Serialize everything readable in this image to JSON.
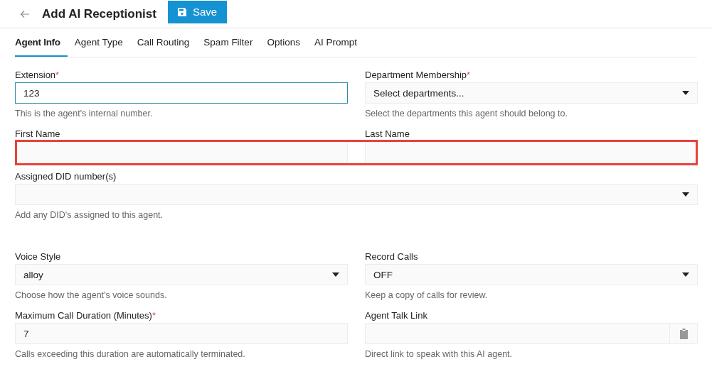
{
  "header": {
    "title": "Add AI Receptionist",
    "save_button": "Save"
  },
  "tabs": [
    {
      "label": "Agent Info",
      "selected": true
    },
    {
      "label": "Agent Type",
      "selected": false
    },
    {
      "label": "Call Routing",
      "selected": false
    },
    {
      "label": "Spam Filter",
      "selected": false
    },
    {
      "label": "Options",
      "selected": false
    },
    {
      "label": "AI Prompt",
      "selected": false
    }
  ],
  "sections": [
    {
      "rows": [
        {
          "fields": [
            {
              "kind": "text",
              "label": "Extension",
              "required_mark": "*",
              "value": "123",
              "focused": true,
              "help": "This is the agent's internal number."
            },
            {
              "kind": "select",
              "label": "Department Membership",
              "required_mark": "*",
              "placeholder": "Select departments...",
              "focused": false,
              "help": "Select the departments this agent should belong to."
            }
          ]
        },
        {
          "highlighted": true,
          "fields": [
            {
              "kind": "text",
              "label": "First Name",
              "focused": false
            },
            {
              "kind": "text",
              "label": "Last Name",
              "focused": false
            }
          ]
        },
        {
          "fields": [
            {
              "kind": "select",
              "label": "Assigned DID number(s)",
              "focused": false,
              "help": "Add any DID's assigned to this agent."
            }
          ]
        }
      ]
    },
    {
      "rows": [
        {
          "fields": [
            {
              "kind": "select",
              "label": "Voice Style",
              "value": "alloy",
              "focused": false,
              "help": "Choose how the agent's voice sounds."
            },
            {
              "kind": "select",
              "label": "Record Calls",
              "value": "OFF",
              "focused": false,
              "help": "Keep a copy of calls for review."
            }
          ]
        },
        {
          "fields": [
            {
              "kind": "text",
              "label": "Maximum Call Duration (Minutes)",
              "required_mark": "*",
              "value": "7",
              "focused": false,
              "help": "Calls exceeding this duration are automatically terminated."
            },
            {
              "kind": "link",
              "label": "Agent Talk Link",
              "focused": false,
              "help": "Direct link to speak with this AI agent."
            }
          ]
        }
      ]
    }
  ]
}
